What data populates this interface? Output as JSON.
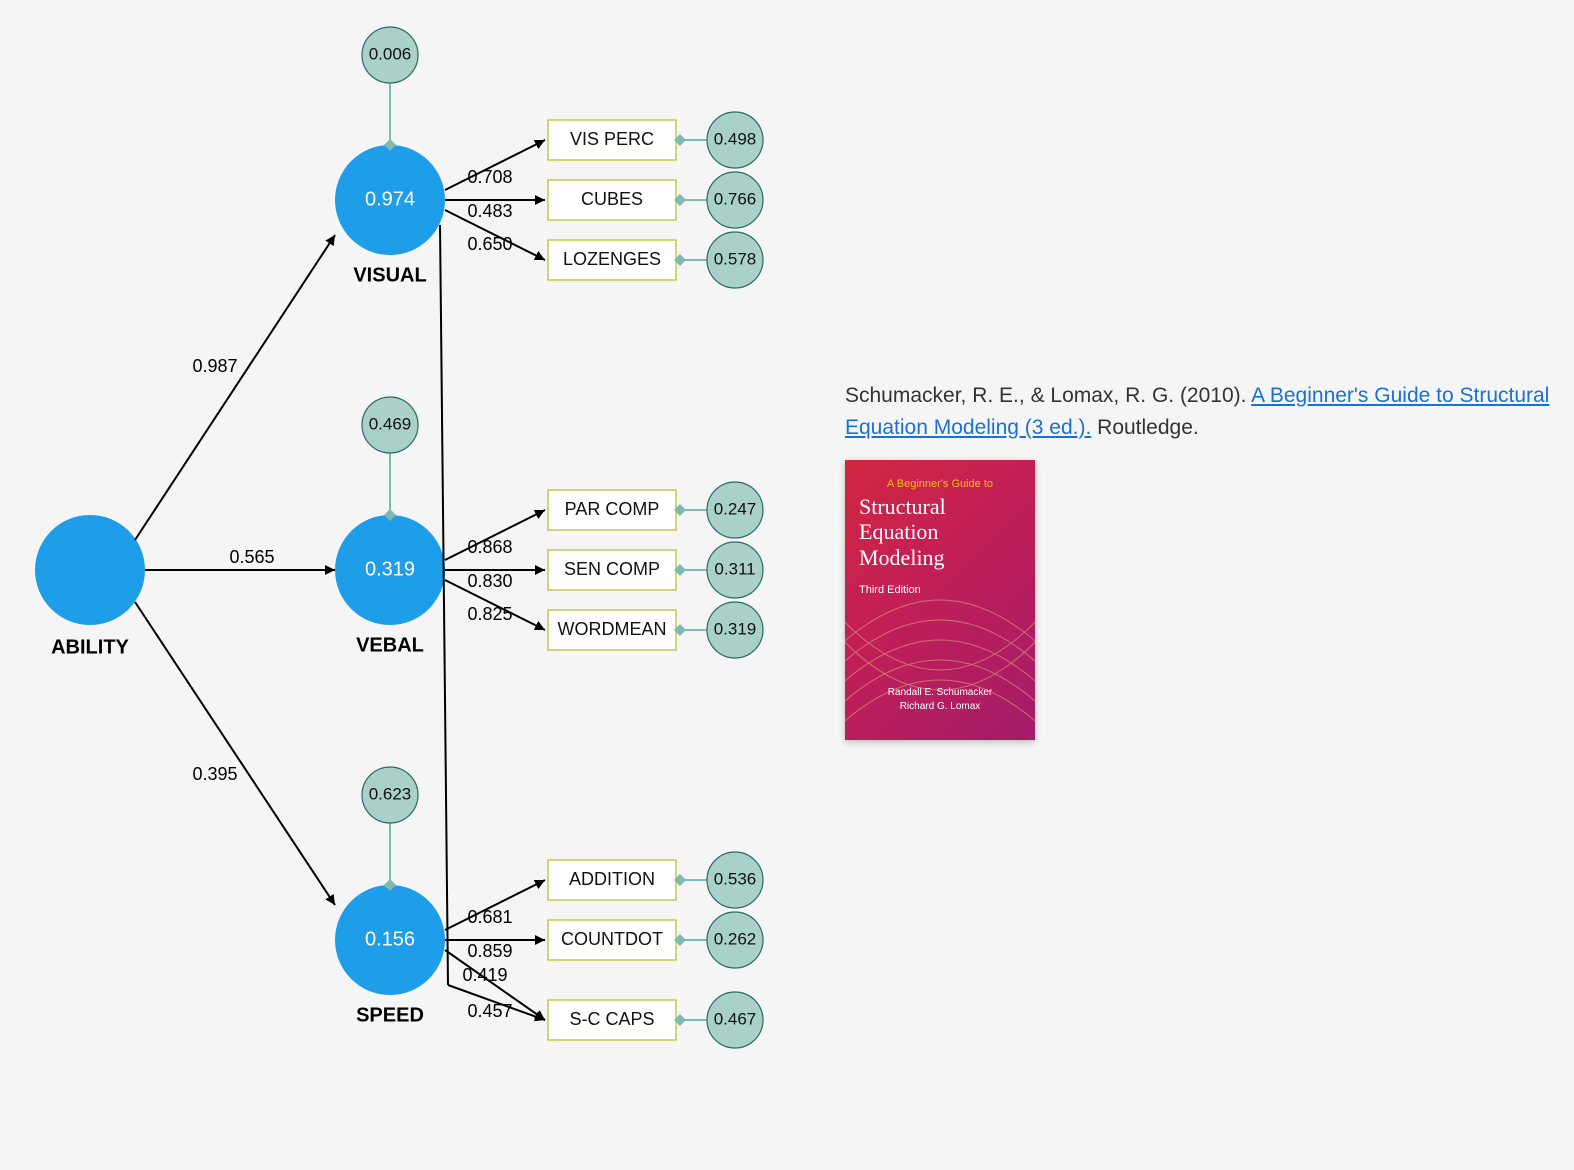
{
  "chart_data": {
    "type": "path-diagram",
    "latent_exogenous": [
      {
        "name": "ABILITY"
      }
    ],
    "latent_endogenous": [
      {
        "name": "VISUAL",
        "r2": 0.974,
        "residual": 0.006
      },
      {
        "name": "VEBAL",
        "r2": 0.319,
        "residual": 0.469
      },
      {
        "name": "SPEED",
        "r2": 0.156,
        "residual": 0.623
      }
    ],
    "observed": [
      {
        "factor": "VISUAL",
        "name": "VIS PERC",
        "loading": 0.708,
        "error": 0.498
      },
      {
        "factor": "VISUAL",
        "name": "CUBES",
        "loading": 0.483,
        "error": 0.766
      },
      {
        "factor": "VISUAL",
        "name": "LOZENGES",
        "loading": 0.65,
        "error": 0.578
      },
      {
        "factor": "VEBAL",
        "name": "PAR COMP",
        "loading": 0.868,
        "error": 0.247
      },
      {
        "factor": "VEBAL",
        "name": "SEN COMP",
        "loading": 0.83,
        "error": 0.311
      },
      {
        "factor": "VEBAL",
        "name": "WORDMEAN",
        "loading": 0.825,
        "error": 0.319
      },
      {
        "factor": "SPEED",
        "name": "ADDITION",
        "loading": 0.681,
        "error": 0.536
      },
      {
        "factor": "SPEED",
        "name": "COUNTDOT",
        "loading": 0.859,
        "error": 0.262
      },
      {
        "factor": "SPEED",
        "name": "S-C CAPS",
        "loading": null,
        "error": 0.467
      }
    ],
    "structural_paths": [
      {
        "from": "ABILITY",
        "to": "VISUAL",
        "value": 0.987
      },
      {
        "from": "ABILITY",
        "to": "VEBAL",
        "value": 0.565
      },
      {
        "from": "ABILITY",
        "to": "SPEED",
        "value": 0.395
      }
    ],
    "cross_loadings": [
      {
        "from": "VISUAL",
        "to": "S-C CAPS",
        "value": 0.419
      },
      {
        "from": "SPEED",
        "to": "S-C CAPS",
        "value": 0.457
      }
    ]
  },
  "labels": {
    "ability": "ABILITY",
    "visual": "VISUAL",
    "vebal": "VEBAL",
    "speed": "SPEED",
    "visual_r2": "0.974",
    "vebal_r2": "0.319",
    "speed_r2": "0.156",
    "visual_res": "0.006",
    "vebal_res": "0.469",
    "speed_res": "0.623",
    "path_visual": "0.987",
    "path_vebal": "0.565",
    "path_speed": "0.395",
    "obs": {
      "visperc": {
        "name": "VIS PERC",
        "load": "0.708",
        "err": "0.498"
      },
      "cubes": {
        "name": "CUBES",
        "load": "0.483",
        "err": "0.766"
      },
      "lozenges": {
        "name": "LOZENGES",
        "load": "0.650",
        "err": "0.578"
      },
      "parcomp": {
        "name": "PAR COMP",
        "load": "0.868",
        "err": "0.247"
      },
      "sencomp": {
        "name": "SEN COMP",
        "load": "0.830",
        "err": "0.311"
      },
      "wordmean": {
        "name": "WORDMEAN",
        "load": "0.825",
        "err": "0.319"
      },
      "addition": {
        "name": "ADDITION",
        "load": "0.681",
        "err": "0.536"
      },
      "countdot": {
        "name": "COUNTDOT",
        "load": "0.859",
        "err": "0.262"
      },
      "sccaps": {
        "name": "S-C CAPS",
        "load": "",
        "err": "0.467"
      }
    },
    "cross_visual_sccaps": "0.419",
    "cross_speed_sccaps": "0.457"
  },
  "citation": {
    "prefix": "Schumacker, R. E., & Lomax, R. G. (2010). ",
    "link_text": "A Beginner's Guide to Structural Equation Modeling (3 ed.).",
    "suffix": " Routledge."
  },
  "book": {
    "small": "A Beginner's Guide to",
    "title1": "Structural",
    "title2": "Equation",
    "title3": "Modeling",
    "edition": "Third Edition",
    "author1": "Randall E. Schumacker",
    "author2": "Richard G. Lomax"
  }
}
